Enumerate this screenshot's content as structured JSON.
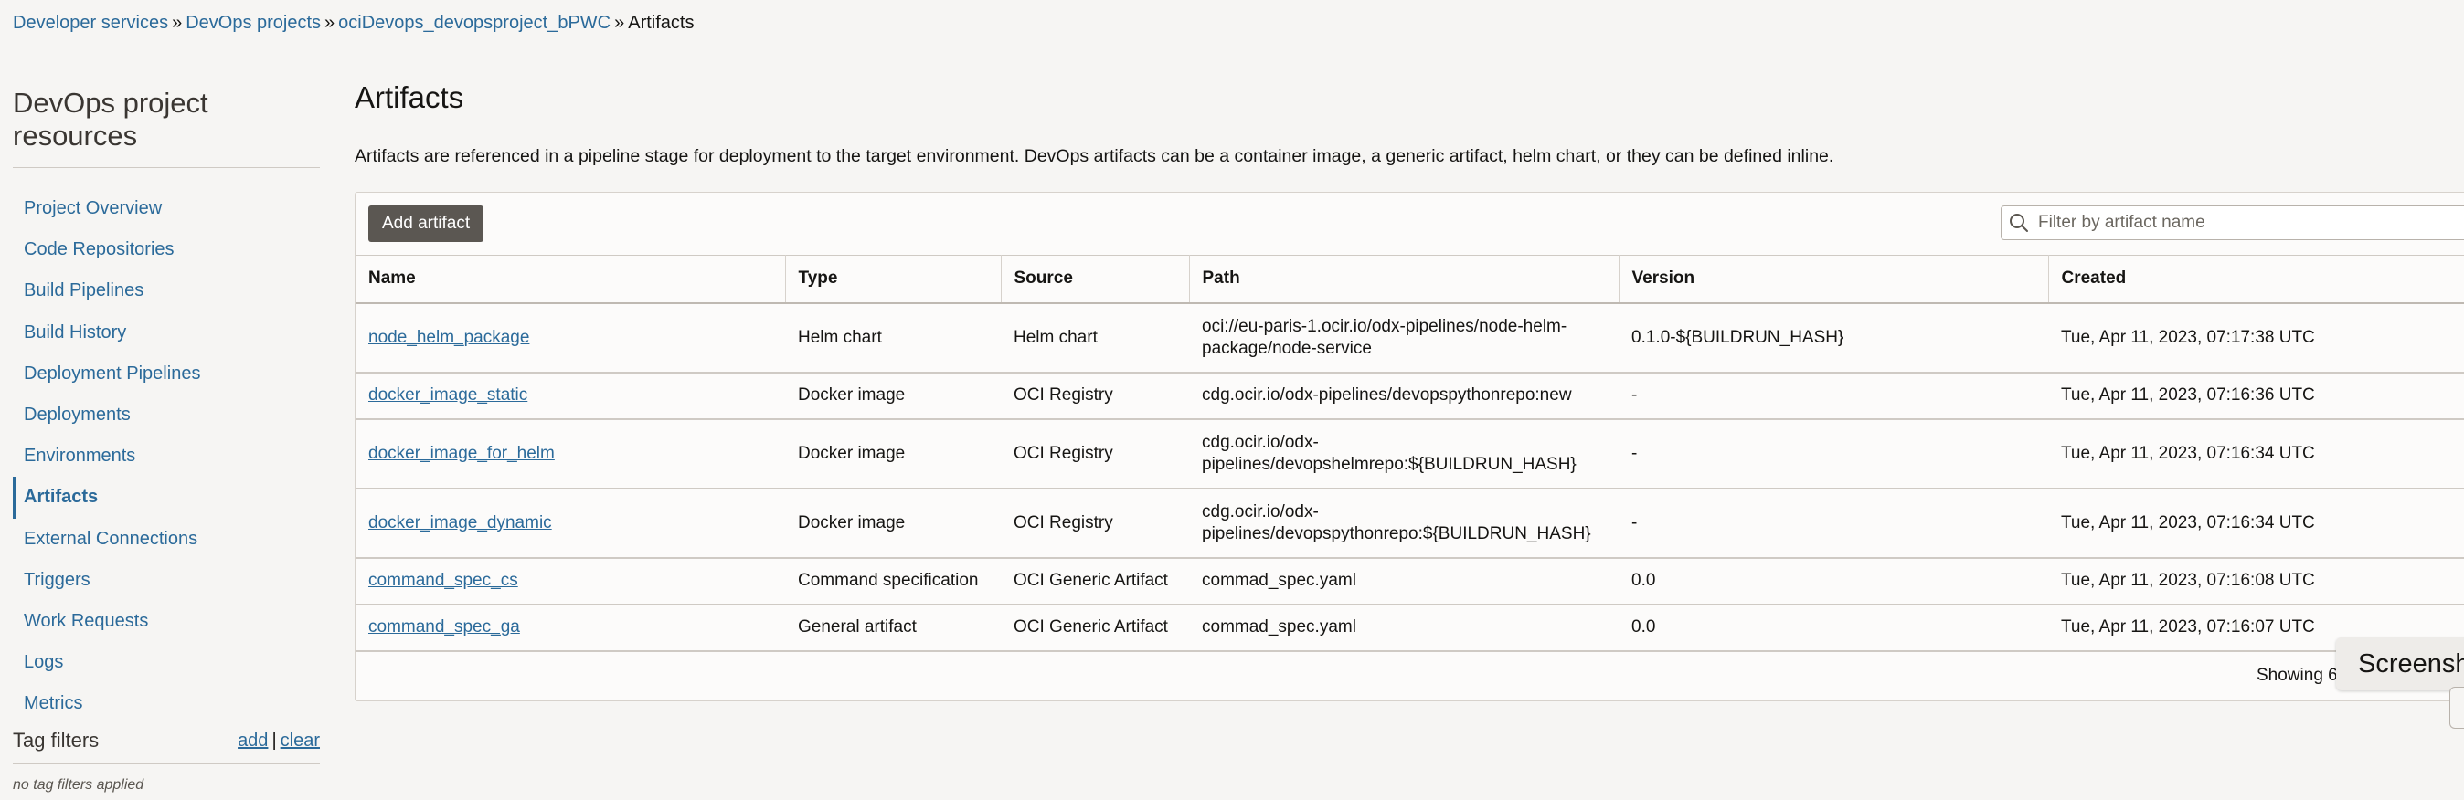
{
  "breadcrumb": {
    "items": [
      "Developer services",
      "DevOps projects",
      "ociDevops_devopsproject_bPWC"
    ],
    "current": "Artifacts",
    "separator": "»"
  },
  "sidebar": {
    "title": "DevOps project resources",
    "items": [
      {
        "label": "Project Overview"
      },
      {
        "label": "Code Repositories"
      },
      {
        "label": "Build Pipelines"
      },
      {
        "label": "Build History"
      },
      {
        "label": "Deployment Pipelines"
      },
      {
        "label": "Deployments"
      },
      {
        "label": "Environments"
      },
      {
        "label": "Artifacts"
      },
      {
        "label": "External Connections"
      },
      {
        "label": "Triggers"
      },
      {
        "label": "Work Requests"
      },
      {
        "label": "Logs"
      },
      {
        "label": "Metrics"
      }
    ],
    "active_item": "Artifacts",
    "tag_filters": {
      "title": "Tag filters",
      "add_label": "add",
      "separator": "|",
      "clear_label": "clear",
      "empty_text": "no tag filters applied"
    }
  },
  "main": {
    "title": "Artifacts",
    "description": "Artifacts are referenced in a pipeline stage for deployment to the target environment. DevOps artifacts can be a container image, a generic artifact, helm chart, or they can be defined inline."
  },
  "toolbar": {
    "add_label": "Add artifact",
    "search_placeholder": "Filter by artifact name"
  },
  "table": {
    "columns": [
      "Name",
      "Type",
      "Source",
      "Path",
      "Version",
      "Created"
    ],
    "rows": [
      {
        "name": "node_helm_package",
        "type": "Helm chart",
        "source": "Helm chart",
        "path_line1": "oci://eu-paris-1.ocir.io/odx-pipelines/node-helm-",
        "path_line2": "package/node-service",
        "version": "0.1.0-${BUILDRUN_HASH}",
        "created": "Tue, Apr 11, 2023, 07:17:38 UTC"
      },
      {
        "name": "docker_image_static",
        "type": "Docker image",
        "source": "OCI Registry",
        "path_line1": "cdg.ocir.io/odx-pipelines/devopspythonrepo:new",
        "path_line2": "",
        "version": "-",
        "created": "Tue, Apr 11, 2023, 07:16:36 UTC"
      },
      {
        "name": "docker_image_for_helm",
        "type": "Docker image",
        "source": "OCI Registry",
        "path_line1": "cdg.ocir.io/odx-",
        "path_line2": "pipelines/devopshelmrepo:${BUILDRUN_HASH}",
        "version": "-",
        "created": "Tue, Apr 11, 2023, 07:16:34 UTC"
      },
      {
        "name": "docker_image_dynamic",
        "type": "Docker image",
        "source": "OCI Registry",
        "path_line1": "cdg.ocir.io/odx-",
        "path_line2": "pipelines/devopspythonrepo:${BUILDRUN_HASH}",
        "version": "-",
        "created": "Tue, Apr 11, 2023, 07:16:34 UTC"
      },
      {
        "name": "command_spec_cs",
        "type": "Command specification",
        "source": "OCI Generic Artifact",
        "path_line1": "commad_spec.yaml",
        "path_line2": "",
        "version": "0.0",
        "created": "Tue, Apr 11, 2023, 07:16:08 UTC"
      },
      {
        "name": "command_spec_ga",
        "type": "General artifact",
        "source": "OCI Generic Artifact",
        "path_line1": "commad_spec.yaml",
        "path_line2": "",
        "version": "0.0",
        "created": "Tue, Apr 11, 2023, 07:16:07 UTC"
      }
    ],
    "footer": "Showing 6"
  },
  "toast": {
    "label": "Screensh"
  }
}
